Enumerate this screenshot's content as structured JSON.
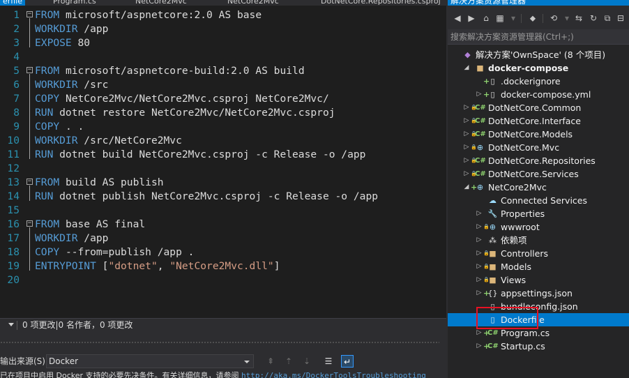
{
  "editor_tabs": [
    {
      "label": "erfile",
      "active": true
    },
    {
      "label": "Program.cs",
      "active": false
    },
    {
      "label": "NetCore2Mvc",
      "active": false
    },
    {
      "label": "NetCore2Mvc",
      "active": false
    },
    {
      "label": "DotNetCore.Repositories.csproj",
      "active": false
    }
  ],
  "code_lines": [
    {
      "n": "1",
      "kw": "FROM",
      "rest": " microsoft/aspnetcore:2.0 AS base"
    },
    {
      "n": "2",
      "kw": "WORKDIR",
      "rest": " /app"
    },
    {
      "n": "3",
      "kw": "EXPOSE",
      "rest": " 80"
    },
    {
      "n": "4",
      "kw": "",
      "rest": ""
    },
    {
      "n": "5",
      "kw": "FROM",
      "rest": " microsoft/aspnetcore-build:2.0 AS build"
    },
    {
      "n": "6",
      "kw": "WORKDIR",
      "rest": " /src"
    },
    {
      "n": "7",
      "kw": "COPY",
      "rest": " NetCore2Mvc/NetCore2Mvc.csproj NetCore2Mvc/"
    },
    {
      "n": "8",
      "kw": "RUN",
      "rest": " dotnet restore NetCore2Mvc/NetCore2Mvc.csproj"
    },
    {
      "n": "9",
      "kw": "COPY",
      "rest": " . ."
    },
    {
      "n": "10",
      "kw": "WORKDIR",
      "rest": " /src/NetCore2Mvc"
    },
    {
      "n": "11",
      "kw": "RUN",
      "rest": " dotnet build NetCore2Mvc.csproj -c Release -o /app"
    },
    {
      "n": "12",
      "kw": "",
      "rest": ""
    },
    {
      "n": "13",
      "kw": "FROM",
      "rest": " build AS publish"
    },
    {
      "n": "14",
      "kw": "RUN",
      "rest": " dotnet publish NetCore2Mvc.csproj -c Release -o /app"
    },
    {
      "n": "15",
      "kw": "",
      "rest": ""
    },
    {
      "n": "16",
      "kw": "FROM",
      "rest": " base AS final"
    },
    {
      "n": "17",
      "kw": "WORKDIR",
      "rest": " /app"
    },
    {
      "n": "18",
      "kw": "COPY",
      "rest": " --from=publish /app ."
    },
    {
      "n": "19",
      "kw": "ENTRYPOINT",
      "rest": " [",
      "s1": "\"dotnet\"",
      "mid": ", ",
      "s2": "\"NetCore2Mvc.dll\"",
      "end": "]"
    },
    {
      "n": "20",
      "kw": "",
      "rest": ""
    }
  ],
  "editor_status": {
    "changes_text": "0 项更改|0 名作者，0 项更改"
  },
  "output": {
    "source_label": "输出来源(S):",
    "source_value": "Docker",
    "message": "已在项目中启用 Docker 支持的必要先决条件。有关详细信息，请参阅",
    "link": "http://aka.ms/DockerToolsTroubleshooting"
  },
  "solution_explorer": {
    "title": "解决方案资源管理器",
    "search_placeholder": "搜索解决方案资源管理器(Ctrl+;)",
    "nodes": [
      {
        "label": "解决方案'OwnSpace' (8 个项目)",
        "icon": "solution-icon",
        "glyph": "◆",
        "expander": "",
        "lock": false,
        "added": false,
        "bold": false,
        "level": 0
      },
      {
        "label": "docker-compose",
        "icon": "folder-icon",
        "glyph": "■",
        "expander": "◢",
        "lock": false,
        "added": false,
        "bold": true,
        "level": 1
      },
      {
        "label": ".dockerignore",
        "icon": "file-icon",
        "glyph": "▯",
        "expander": "",
        "lock": false,
        "added": true,
        "bold": false,
        "level": 2
      },
      {
        "label": "docker-compose.yml",
        "icon": "file-icon",
        "glyph": "▯",
        "expander": "▷",
        "lock": false,
        "added": true,
        "bold": false,
        "level": 2
      },
      {
        "label": "DotNetCore.Common",
        "icon": "csharp-project-icon",
        "glyph": "C#",
        "expander": "▷",
        "lock": true,
        "added": false,
        "bold": false,
        "level": 1
      },
      {
        "label": "DotNetCore.Interface",
        "icon": "csharp-project-icon",
        "glyph": "C#",
        "expander": "▷",
        "lock": true,
        "added": false,
        "bold": false,
        "level": 1
      },
      {
        "label": "DotNetCore.Models",
        "icon": "csharp-project-icon",
        "glyph": "C#",
        "expander": "▷",
        "lock": true,
        "added": false,
        "bold": false,
        "level": 1
      },
      {
        "label": "DotNetCore.Mvc",
        "icon": "web-project-icon",
        "glyph": "⊕",
        "expander": "▷",
        "lock": true,
        "added": false,
        "bold": false,
        "level": 1
      },
      {
        "label": "DotNetCore.Repositories",
        "icon": "csharp-project-icon",
        "glyph": "C#",
        "expander": "▷",
        "lock": true,
        "added": false,
        "bold": false,
        "level": 1
      },
      {
        "label": "DotNetCore.Services",
        "icon": "csharp-project-icon",
        "glyph": "C#",
        "expander": "▷",
        "lock": true,
        "added": false,
        "bold": false,
        "level": 1
      },
      {
        "label": "NetCore2Mvc",
        "icon": "web-project-icon",
        "glyph": "⊕",
        "expander": "◢",
        "lock": false,
        "added": true,
        "bold": false,
        "level": 1
      },
      {
        "label": "Connected Services",
        "icon": "connected-services-icon",
        "glyph": "☁",
        "expander": "",
        "lock": false,
        "added": false,
        "bold": false,
        "level": 2
      },
      {
        "label": "Properties",
        "icon": "wrench-icon",
        "glyph": "🔧",
        "expander": "▷",
        "lock": false,
        "added": false,
        "bold": false,
        "level": 2
      },
      {
        "label": "wwwroot",
        "icon": "globe-icon",
        "glyph": "⊕",
        "expander": "▷",
        "lock": true,
        "added": false,
        "bold": false,
        "level": 2
      },
      {
        "label": "依赖项",
        "icon": "dependencies-icon",
        "glyph": "⁂",
        "expander": "▷",
        "lock": false,
        "added": false,
        "bold": false,
        "level": 2
      },
      {
        "label": "Controllers",
        "icon": "folder-icon",
        "glyph": "■",
        "expander": "▷",
        "lock": true,
        "added": false,
        "bold": false,
        "level": 2
      },
      {
        "label": "Models",
        "icon": "folder-icon",
        "glyph": "■",
        "expander": "▷",
        "lock": true,
        "added": false,
        "bold": false,
        "level": 2
      },
      {
        "label": "Views",
        "icon": "folder-icon",
        "glyph": "■",
        "expander": "▷",
        "lock": true,
        "added": false,
        "bold": false,
        "level": 2
      },
      {
        "label": "appsettings.json",
        "icon": "json-file-icon",
        "glyph": "{}",
        "expander": "▷",
        "lock": false,
        "added": true,
        "bold": false,
        "level": 2
      },
      {
        "label": "bundleconfig.json",
        "icon": "file-icon",
        "glyph": "▯",
        "expander": "",
        "lock": false,
        "added": false,
        "bold": false,
        "level": 2
      },
      {
        "label": "Dockerfile",
        "icon": "file-icon",
        "glyph": "▯",
        "expander": "",
        "lock": false,
        "added": false,
        "bold": false,
        "level": 2,
        "selected": true
      },
      {
        "label": "Program.cs",
        "icon": "csharp-file-icon",
        "glyph": "C#",
        "expander": "▷",
        "lock": false,
        "added": true,
        "bold": false,
        "level": 2
      },
      {
        "label": "Startup.cs",
        "icon": "csharp-file-icon",
        "glyph": "C#",
        "expander": "▷",
        "lock": false,
        "added": true,
        "bold": false,
        "level": 2
      }
    ]
  },
  "colors": {
    "accent": "#007acc",
    "keyword": "#569cd6",
    "string": "#d69d85",
    "line_number": "#2b91af",
    "highlight_box": "#e81123"
  }
}
